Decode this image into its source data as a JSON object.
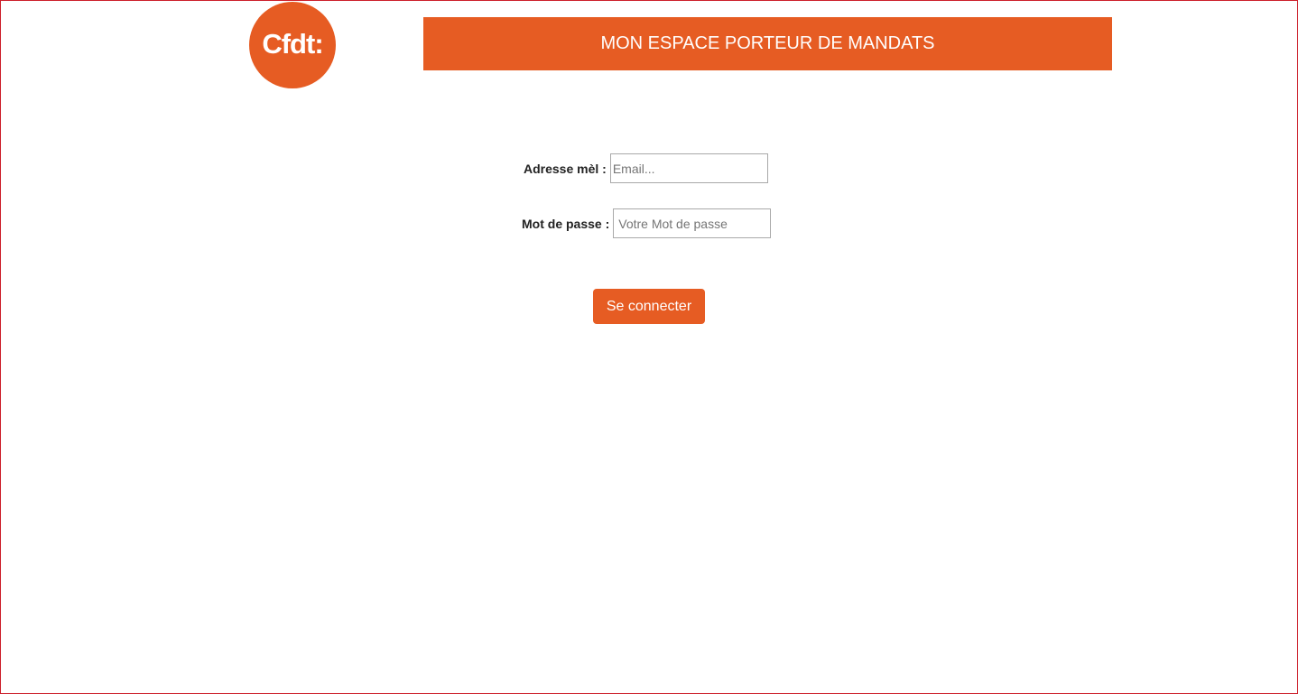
{
  "colors": {
    "brand": "#e65c23",
    "frame_border": "#cc1f2b"
  },
  "logo": {
    "text": "Cfdt:"
  },
  "header": {
    "title": "MON ESPACE PORTEUR DE MANDATS"
  },
  "form": {
    "email": {
      "label": "Adresse mèl :",
      "value": "",
      "placeholder": "Email..."
    },
    "password": {
      "label": "Mot de passe :",
      "value": "",
      "placeholder": "Votre Mot de passe"
    },
    "submit_label": "Se connecter"
  }
}
